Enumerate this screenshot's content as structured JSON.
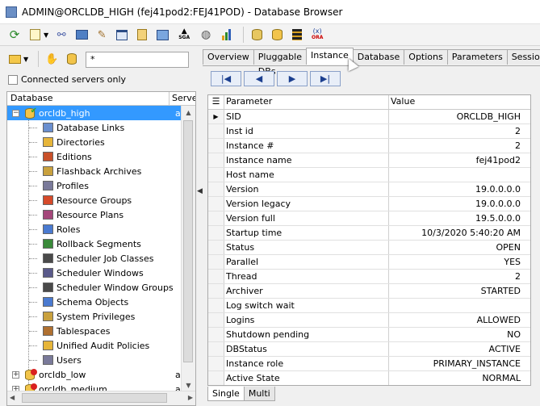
{
  "window": {
    "title": "ADMIN@ORCLDB_HIGH (fej41pod2:FEJ41POD) - Database Browser"
  },
  "toolbar": {
    "icons": [
      "refresh-icon",
      "script-icon",
      "connect-icon",
      "monitor-icon",
      "edit-icon",
      "window-icon",
      "layers-icon",
      "chart-image-icon",
      "sga-icon",
      "globe-icon",
      "bar-chart-icon",
      "db-search-icon",
      "db-icon",
      "stack-icon",
      "ora-icon"
    ],
    "sga_label": "SGA",
    "ora_label": "ORA"
  },
  "left": {
    "filter_value": "*",
    "connected_only_label": "Connected servers only",
    "tree_header": {
      "database": "Database",
      "server": "Server"
    },
    "root": {
      "label": "orcldb_high",
      "server_fragment": "a"
    },
    "children": [
      "Database Links",
      "Directories",
      "Editions",
      "Flashback Archives",
      "Profiles",
      "Resource Groups",
      "Resource Plans",
      "Roles",
      "Rollback Segments",
      "Scheduler Job Classes",
      "Scheduler Windows",
      "Scheduler Window Groups",
      "Schema Objects",
      "System Privileges",
      "Tablespaces",
      "Unified Audit Policies",
      "Users"
    ],
    "other_servers": [
      {
        "label": "orcldb_low",
        "server_fragment": "a"
      },
      {
        "label": "orcldb_medium",
        "server_fragment": "a"
      }
    ]
  },
  "tabs": [
    "Overview",
    "Pluggable DBs",
    "Instance",
    "Database",
    "Options",
    "Parameters",
    "Sessions"
  ],
  "active_tab": "Instance",
  "nav": {
    "first": "|◀",
    "prev": "◀",
    "next": "▶",
    "last": "▶|"
  },
  "grid": {
    "col_parameter": "Parameter",
    "col_value": "Value",
    "rows": [
      [
        "SID",
        "ORCLDB_HIGH"
      ],
      [
        "Inst id",
        "2"
      ],
      [
        "Instance #",
        "2"
      ],
      [
        "Instance name",
        "fej41pod2"
      ],
      [
        "Host name",
        ""
      ],
      [
        "Version",
        "19.0.0.0.0"
      ],
      [
        "Version legacy",
        "19.0.0.0.0"
      ],
      [
        "Version full",
        "19.5.0.0.0"
      ],
      [
        "Startup time",
        "10/3/2020 5:40:20 AM"
      ],
      [
        "Status",
        "OPEN"
      ],
      [
        "Parallel",
        "YES"
      ],
      [
        "Thread",
        "2"
      ],
      [
        "Archiver",
        "STARTED"
      ],
      [
        "Log switch wait",
        ""
      ],
      [
        "Logins",
        "ALLOWED"
      ],
      [
        "Shutdown pending",
        "NO"
      ],
      [
        "DBStatus",
        "ACTIVE"
      ],
      [
        "Instance role",
        "PRIMARY_INSTANCE"
      ],
      [
        "Active State",
        "NORMAL"
      ]
    ]
  },
  "bottom_tabs": [
    "Single",
    "Multi"
  ],
  "active_bottom_tab": "Single"
}
